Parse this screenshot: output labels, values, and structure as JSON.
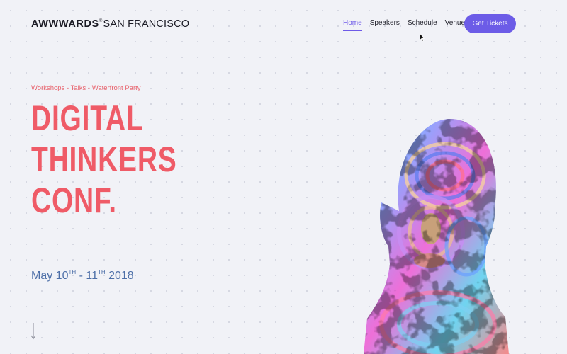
{
  "header": {
    "logo_brand": "AWWWARDS",
    "logo_reg": "®",
    "logo_city": "SAN FRANCISCO",
    "menu": [
      {
        "label": "Home",
        "active": true
      },
      {
        "label": "Speakers",
        "active": false
      },
      {
        "label": "Schedule",
        "active": false
      },
      {
        "label": "Venue",
        "active": false
      }
    ],
    "cta_label": "Get Tickets"
  },
  "hero": {
    "tagline": "Workshops - Talks - Waterfront Party",
    "headline_lines": [
      "DIGITAL",
      "THINKERS",
      "CONF."
    ],
    "date_day1": "May 10",
    "date_sup1": "TH",
    "date_sep": " - 11",
    "date_sup2": "TH",
    "date_year": " 2018"
  },
  "icons": {
    "cursor": "mouse-pointer-icon",
    "scroll": "arrow-down-icon",
    "image": "rainbow-bust-sculpture"
  },
  "colors": {
    "accent": "#6c5ce7",
    "headline": "#ef5b67",
    "tagline": "#e8626c",
    "dates": "#4d6fa8",
    "background": "#f1f2f7"
  }
}
